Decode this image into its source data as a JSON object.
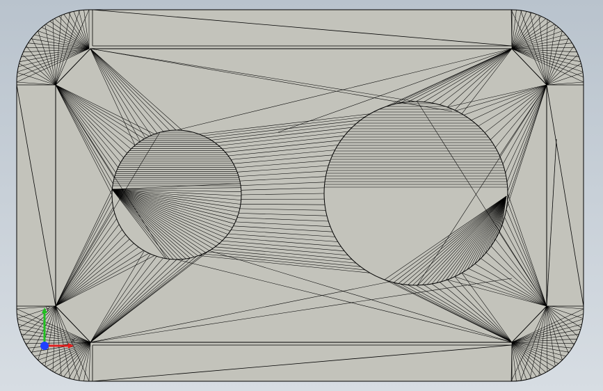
{
  "viewport": {
    "background_top": "#b9c3cd",
    "background_bottom": "#d7dde3",
    "part_fill": "#c3c3bb",
    "edge_color": "#000000"
  },
  "triad": {
    "x_label": "X",
    "y_label": "Y",
    "x_color": "#e02020",
    "y_color": "#20c020",
    "z_color": "#2040ff"
  }
}
